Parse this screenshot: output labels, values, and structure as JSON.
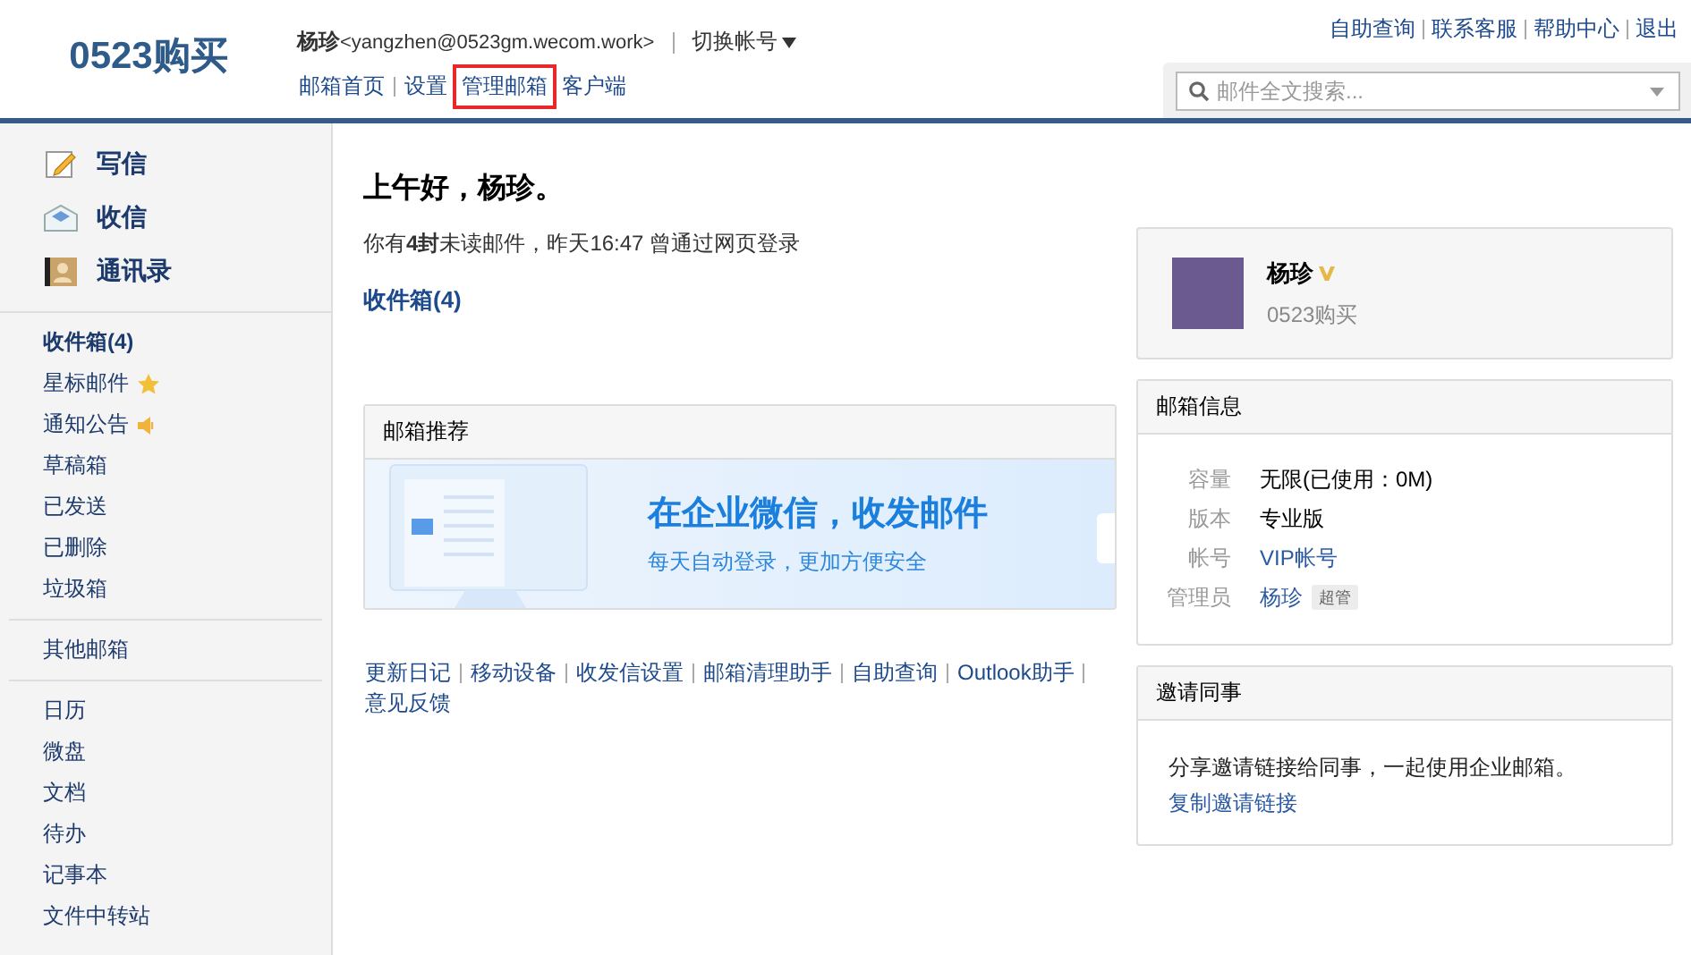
{
  "logo": "0523购买",
  "account": {
    "name": "杨珍",
    "email": "<yangzhen@0523gm.wecom.work>",
    "switch": "切换帐号"
  },
  "nav": [
    {
      "label": "邮箱首页",
      "highlighted": false
    },
    {
      "label": "设置",
      "highlighted": false
    },
    {
      "label": "管理邮箱",
      "highlighted": true
    },
    {
      "label": "客户端",
      "highlighted": false
    }
  ],
  "top_links": [
    "自助查询",
    "联系客服",
    "帮助中心",
    "退出"
  ],
  "search": {
    "placeholder": "邮件全文搜索..."
  },
  "sidebar": {
    "actions": [
      {
        "kind": "compose",
        "label": "写信"
      },
      {
        "kind": "receive",
        "label": "收信"
      },
      {
        "kind": "contacts",
        "label": "通讯录"
      }
    ],
    "folders": [
      {
        "label": "收件箱(4)",
        "unread": true,
        "kind": "plain"
      },
      {
        "label": "星标邮件",
        "unread": false,
        "kind": "starred"
      },
      {
        "label": "通知公告",
        "unread": false,
        "kind": "notice"
      },
      {
        "label": "草稿箱",
        "unread": false,
        "kind": "plain"
      },
      {
        "label": "已发送",
        "unread": false,
        "kind": "plain"
      },
      {
        "label": "已删除",
        "unread": false,
        "kind": "plain"
      },
      {
        "label": "垃圾箱",
        "unread": false,
        "kind": "plain"
      }
    ],
    "other": "其他邮箱",
    "apps": [
      "日历",
      "微盘",
      "文档",
      "待办",
      "记事本",
      "文件中转站"
    ]
  },
  "greeting": "上午好，杨珍。",
  "login_info": "你有**4封**未读邮件，昨天16:47 曾通过网页登录",
  "inbox_link": "收件箱(4)",
  "promo": {
    "title": "邮箱推荐",
    "headline": "在企业微信，收发邮件",
    "subline": "每天自动登录，更加方便安全"
  },
  "footer_links": [
    "更新日记",
    "移动设备",
    "收发信设置",
    "邮箱清理助手",
    "自助查询",
    "Outlook助手",
    "意见反馈"
  ],
  "profile": {
    "name": "杨珍",
    "company": "0523购买"
  },
  "mailbox_info": {
    "title": "邮箱信息",
    "rows": [
      {
        "label": "容量",
        "value": "无限(已使用：0M)",
        "kind": "text"
      },
      {
        "label": "版本",
        "value": "专业版",
        "kind": "text"
      },
      {
        "label": "帐号",
        "value": "VIP帐号",
        "kind": "link"
      },
      {
        "label": "管理员",
        "value": "杨珍",
        "kind": "admin",
        "tag": "超管"
      }
    ]
  },
  "invite": {
    "title": "邀请同事",
    "text": "分享邀请链接给同事，一起使用企业邮箱。",
    "link": "复制邀请链接"
  }
}
